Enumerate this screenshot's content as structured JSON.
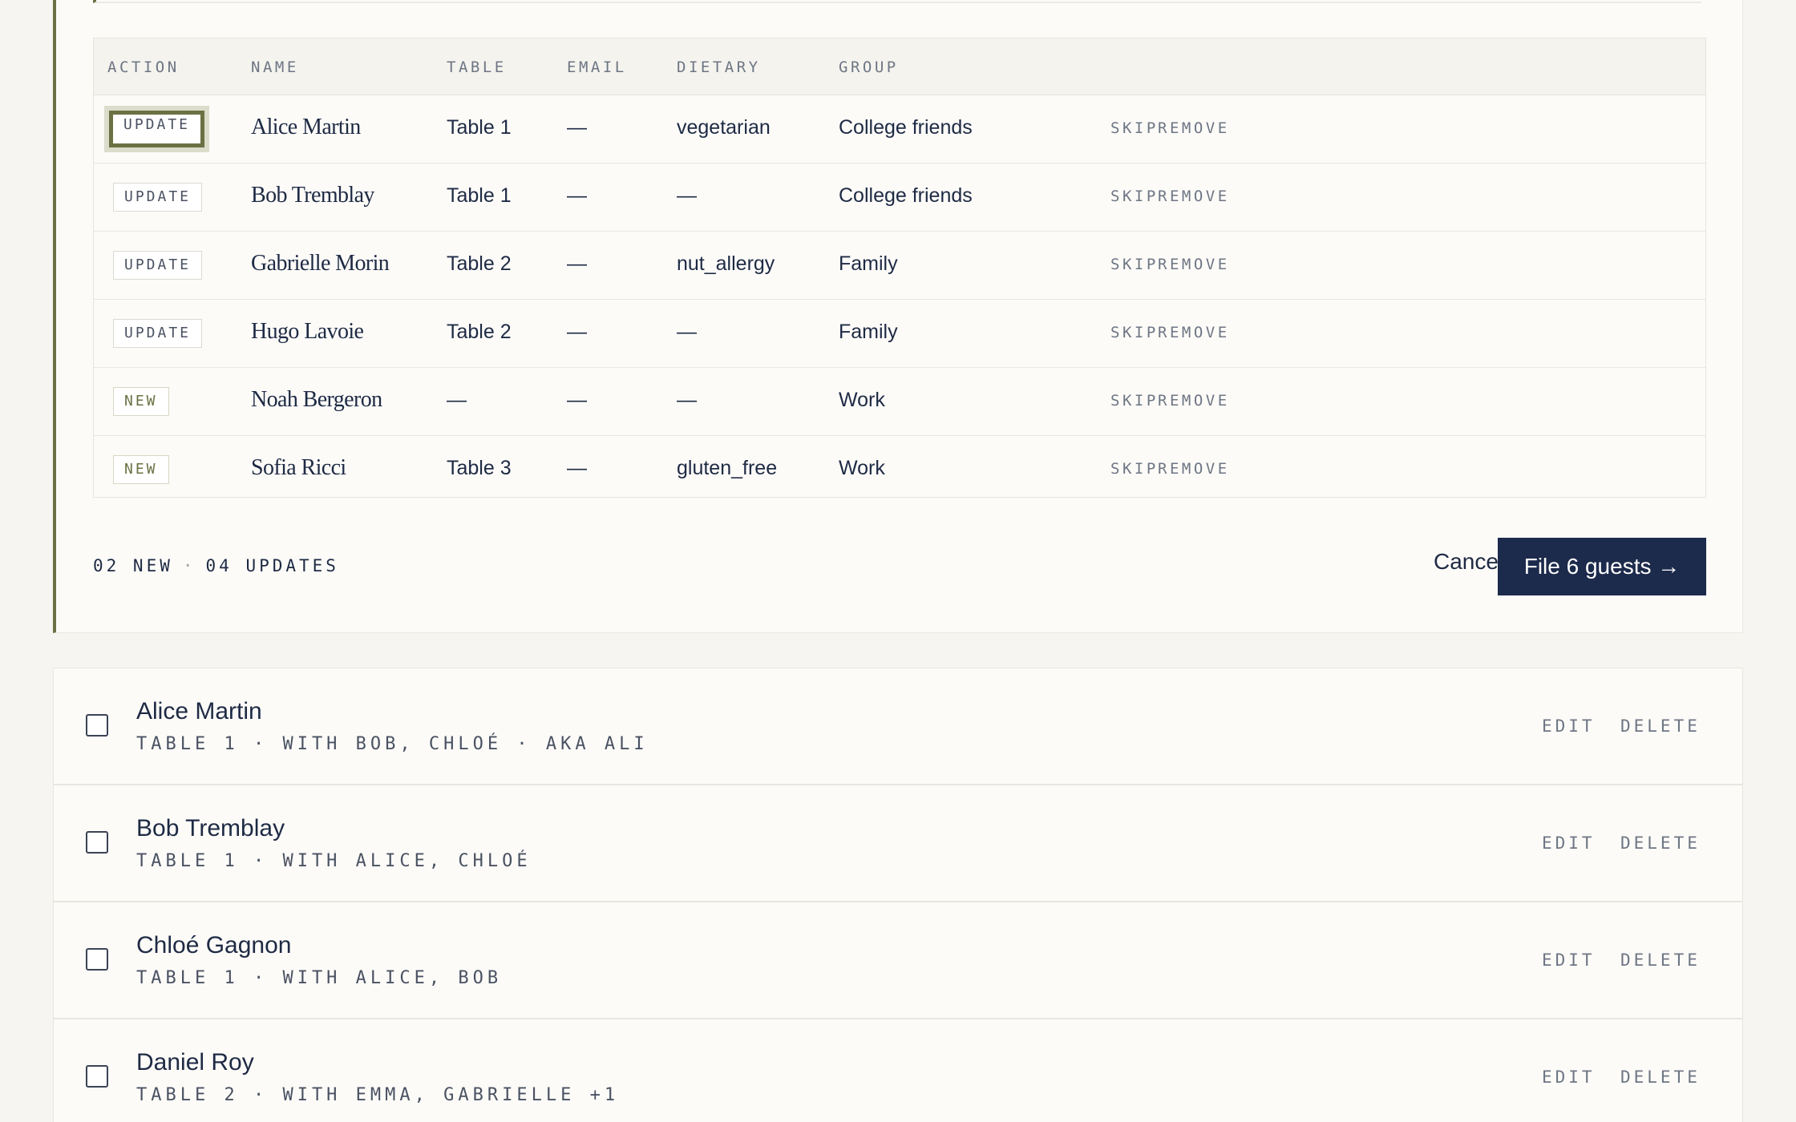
{
  "import": {
    "columns": [
      "ACTION",
      "NAME",
      "TABLE",
      "EMAIL",
      "DIETARY",
      "GROUP"
    ],
    "rows": [
      {
        "action": "UPDATE",
        "name": "Alice Martin",
        "table": "Table 1",
        "email": "—",
        "dietary": "vegetarian",
        "group": "College friends",
        "skip": "SKIP",
        "remove": "REMOVE"
      },
      {
        "action": "UPDATE",
        "name": "Bob Tremblay",
        "table": "Table 1",
        "email": "—",
        "dietary": "—",
        "group": "College friends",
        "skip": "SKIP",
        "remove": "REMOVE"
      },
      {
        "action": "UPDATE",
        "name": "Gabrielle Morin",
        "table": "Table 2",
        "email": "—",
        "dietary": "nut_allergy",
        "group": "Family",
        "skip": "SKIP",
        "remove": "REMOVE"
      },
      {
        "action": "UPDATE",
        "name": "Hugo Lavoie",
        "table": "Table 2",
        "email": "—",
        "dietary": "—",
        "group": "Family",
        "skip": "SKIP",
        "remove": "REMOVE"
      },
      {
        "action": "NEW",
        "name": "Noah Bergeron",
        "table": "—",
        "email": "—",
        "dietary": "—",
        "group": "Work",
        "skip": "SKIP",
        "remove": "REMOVE"
      },
      {
        "action": "NEW",
        "name": "Sofia Ricci",
        "table": "Table 3",
        "email": "—",
        "dietary": "gluten_free",
        "group": "Work",
        "skip": "SKIP",
        "remove": "REMOVE"
      }
    ],
    "summary_new": "02 NEW",
    "summary_sep": "·",
    "summary_updates": "04 UPDATES",
    "cancel_label": "Cancel",
    "file_label": "File 6 guests →"
  },
  "guests": [
    {
      "name": "Alice Martin",
      "meta": "TABLE 1 · WITH BOB, CHLOÉ · AKA ALI",
      "edit": "EDIT",
      "delete": "DELETE"
    },
    {
      "name": "Bob Tremblay",
      "meta": "TABLE 1 · WITH ALICE, CHLOÉ",
      "edit": "EDIT",
      "delete": "DELETE"
    },
    {
      "name": "Chloé Gagnon",
      "meta": "TABLE 1 · WITH ALICE, BOB",
      "edit": "EDIT",
      "delete": "DELETE"
    },
    {
      "name": "Daniel Roy",
      "meta": "TABLE 2 · WITH EMMA, GABRIELLE +1",
      "edit": "EDIT",
      "delete": "DELETE"
    }
  ],
  "colors": {
    "accent": "#6b7143",
    "primary_button": "#1c2a4b",
    "text": "#1e2a44"
  }
}
